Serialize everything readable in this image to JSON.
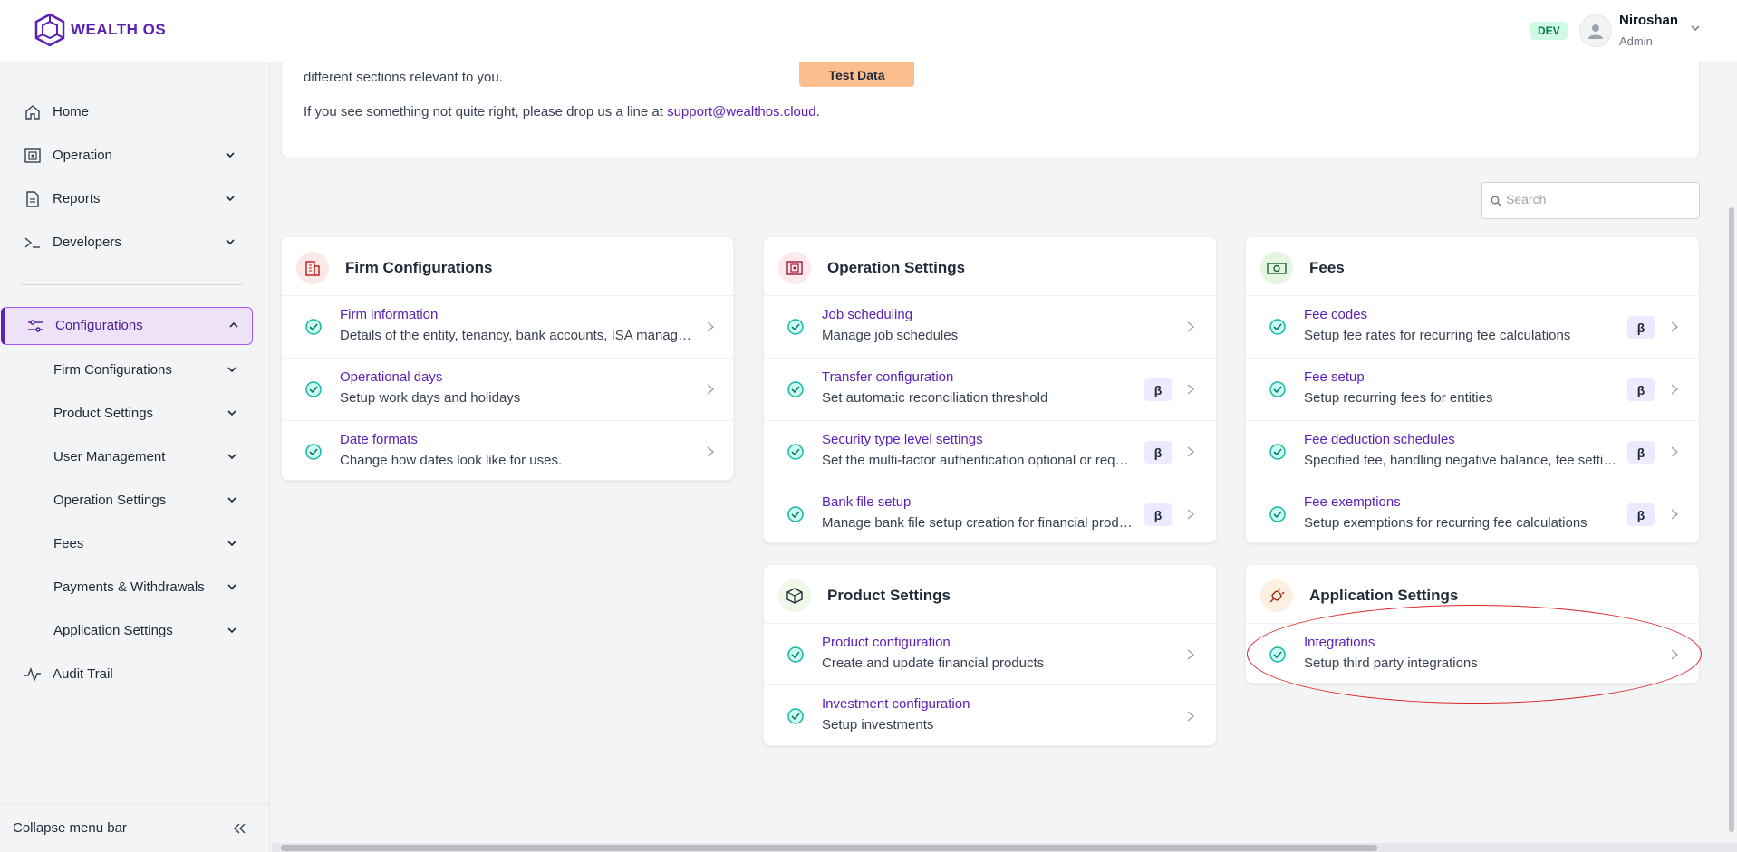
{
  "header": {
    "logo_text": "WEALTH OS",
    "env_badge": "DEV",
    "user_name": "Niroshan",
    "user_role": "Admin"
  },
  "sidebar": {
    "items": [
      {
        "label": "Home",
        "icon": "home-icon"
      },
      {
        "label": "Operation",
        "icon": "operation-icon"
      },
      {
        "label": "Reports",
        "icon": "document-icon"
      },
      {
        "label": "Developers",
        "icon": "terminal-icon"
      }
    ],
    "active": {
      "label": "Configurations",
      "icon": "sliders-icon"
    },
    "sub_items": [
      "Firm Configurations",
      "Product Settings",
      "User Management",
      "Operation Settings",
      "Fees",
      "Payments & Withdrawals",
      "Application Settings"
    ],
    "audit": {
      "label": "Audit Trail",
      "icon": "activity-icon"
    },
    "collapse_label": "Collapse menu bar"
  },
  "info": {
    "line1": "different sections relevant to you.",
    "line2_prefix": "If you see something not quite right, please drop us a line at ",
    "email": "support@wealthos.cloud",
    "line2_suffix": ".",
    "test_badge": "Test Data"
  },
  "search": {
    "placeholder": "Search"
  },
  "cards": {
    "firm": {
      "title": "Firm Configurations",
      "rows": [
        {
          "title": "Firm information",
          "desc": "Details of the entity, tenancy, bank accounts, ISA manager etc."
        },
        {
          "title": "Operational days",
          "desc": "Setup work days and holidays"
        },
        {
          "title": "Date formats",
          "desc": "Change how dates look like for uses."
        }
      ]
    },
    "operation": {
      "title": "Operation Settings",
      "rows": [
        {
          "title": "Job scheduling",
          "desc": "Manage job schedules",
          "beta": ""
        },
        {
          "title": "Transfer configuration",
          "desc": "Set automatic reconciliation threshold",
          "beta": "β"
        },
        {
          "title": "Security type level settings",
          "desc": "Set the multi-factor authentication optional or required",
          "beta": "β"
        },
        {
          "title": "Bank file setup",
          "desc": "Manage bank file setup creation for financial products",
          "beta": "β"
        }
      ]
    },
    "fees": {
      "title": "Fees",
      "rows": [
        {
          "title": "Fee codes",
          "desc": "Setup fee rates for recurring fee calculations",
          "beta": "β"
        },
        {
          "title": "Fee setup",
          "desc": "Setup recurring fees for entities",
          "beta": "β"
        },
        {
          "title": "Fee deduction schedules",
          "desc": "Specified fee, handling negative balance, fee settings",
          "beta": "β"
        },
        {
          "title": "Fee exemptions",
          "desc": "Setup exemptions for recurring fee calculations",
          "beta": "β"
        }
      ]
    },
    "product": {
      "title": "Product Settings",
      "rows": [
        {
          "title": "Product configuration",
          "desc": "Create and update financial products"
        },
        {
          "title": "Investment configuration",
          "desc": "Setup investments"
        }
      ]
    },
    "application": {
      "title": "Application Settings",
      "rows": [
        {
          "title": "Integrations",
          "desc": "Setup third party integrations"
        }
      ]
    }
  },
  "colors": {
    "brand": "#5b21b6",
    "teal": "#14b8a6",
    "beta_bg": "#ede9fe",
    "test_badge": "#fbbf8f"
  }
}
